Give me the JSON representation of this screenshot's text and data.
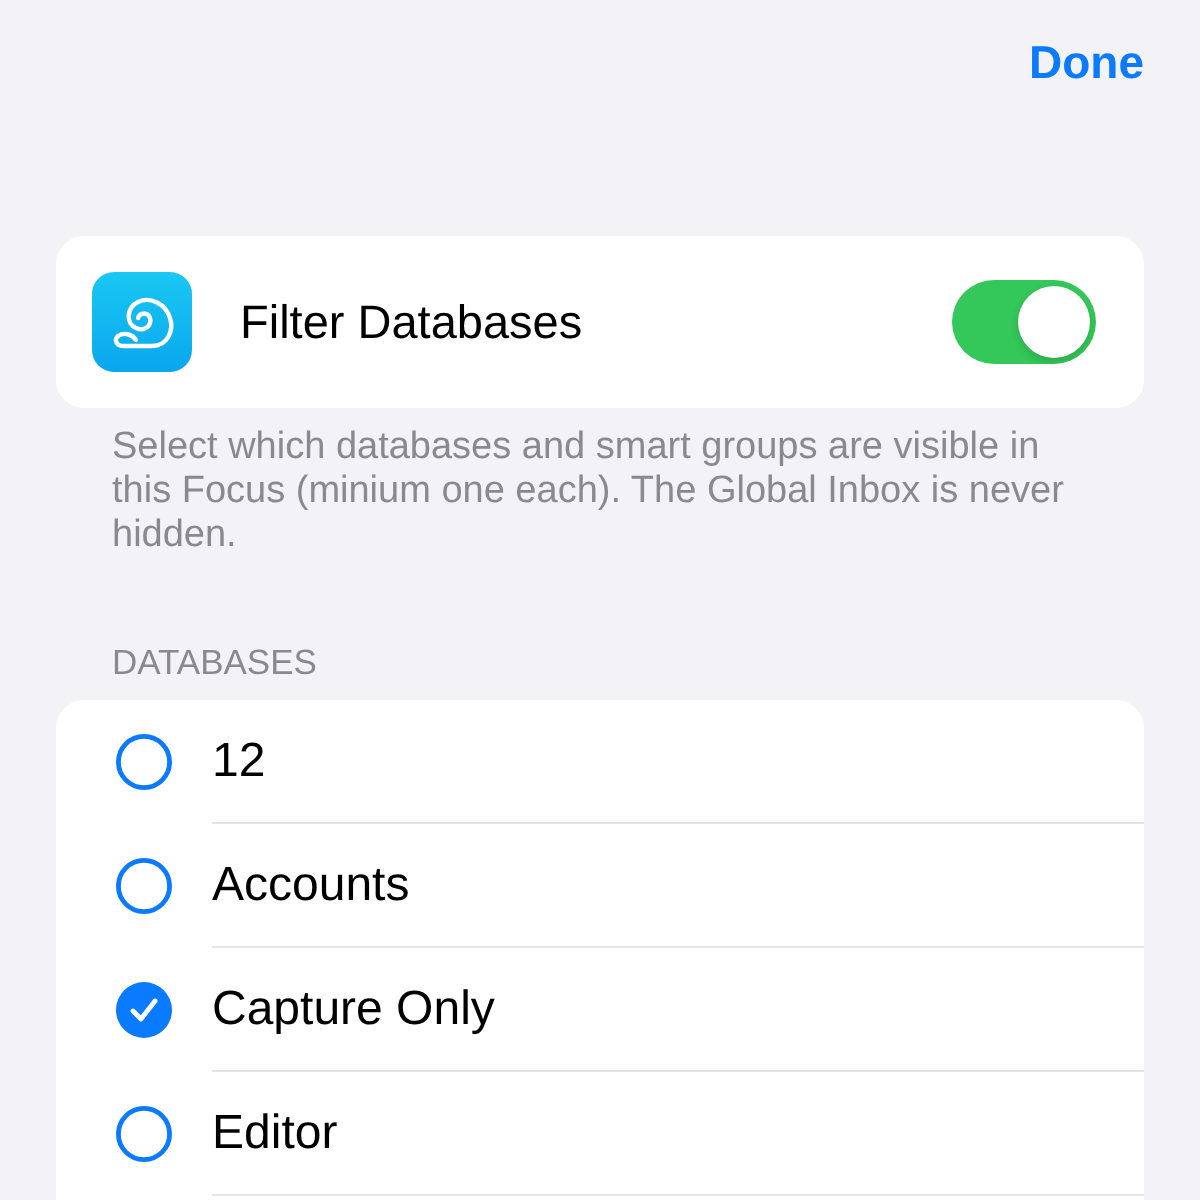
{
  "nav": {
    "done": "Done"
  },
  "filter": {
    "title": "Filter Databases",
    "on": true
  },
  "footer": "Select which databases and smart groups are visible in this Focus (minium one each). The Global Inbox is never hidden.",
  "databases": {
    "header": "DATABASES",
    "items": [
      {
        "name": "12",
        "selected": false
      },
      {
        "name": "Accounts",
        "selected": false
      },
      {
        "name": "Capture Only",
        "selected": true
      },
      {
        "name": "Editor",
        "selected": false
      }
    ]
  }
}
